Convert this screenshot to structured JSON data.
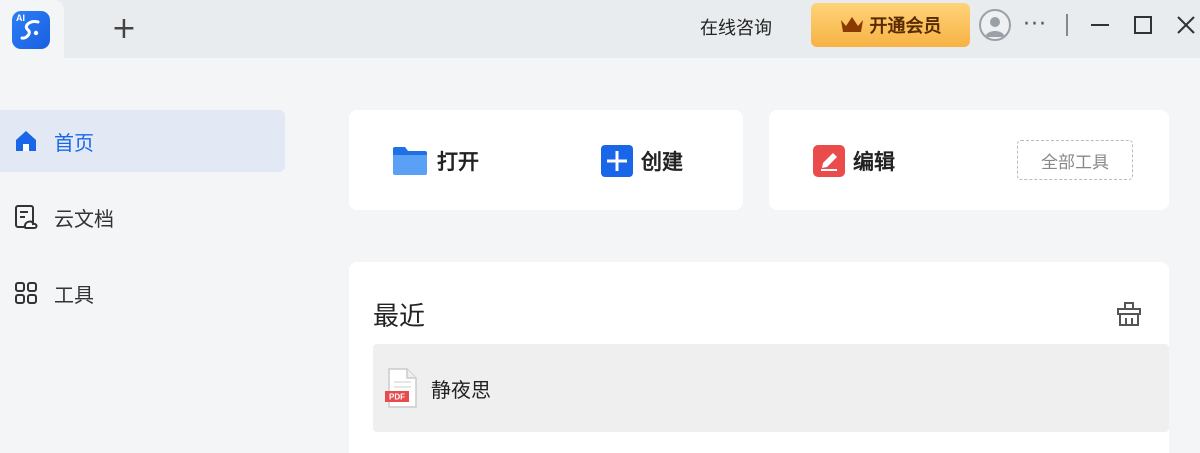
{
  "titlebar": {
    "logo_text": "AI",
    "new_tab_glyph": "+",
    "consult_label": "在线咨询",
    "vip_label": "开通会员",
    "more_glyph": "···"
  },
  "sidebar": {
    "items": [
      {
        "label": "首页",
        "icon": "home-icon",
        "active": true
      },
      {
        "label": "云文档",
        "icon": "cloud-doc-icon",
        "active": false
      },
      {
        "label": "工具",
        "icon": "apps-grid-icon",
        "active": false
      }
    ]
  },
  "actions": {
    "open_label": "打开",
    "create_label": "创建",
    "edit_label": "编辑",
    "all_tools_label": "全部工具"
  },
  "recent": {
    "title": "最近",
    "files": [
      {
        "name": "静夜思",
        "type_badge": "PDF"
      }
    ]
  },
  "colors": {
    "accent": "#1a66e8",
    "vip": "#f7b244",
    "edit": "#ea4b4b",
    "pdf": "#e84b4b"
  }
}
